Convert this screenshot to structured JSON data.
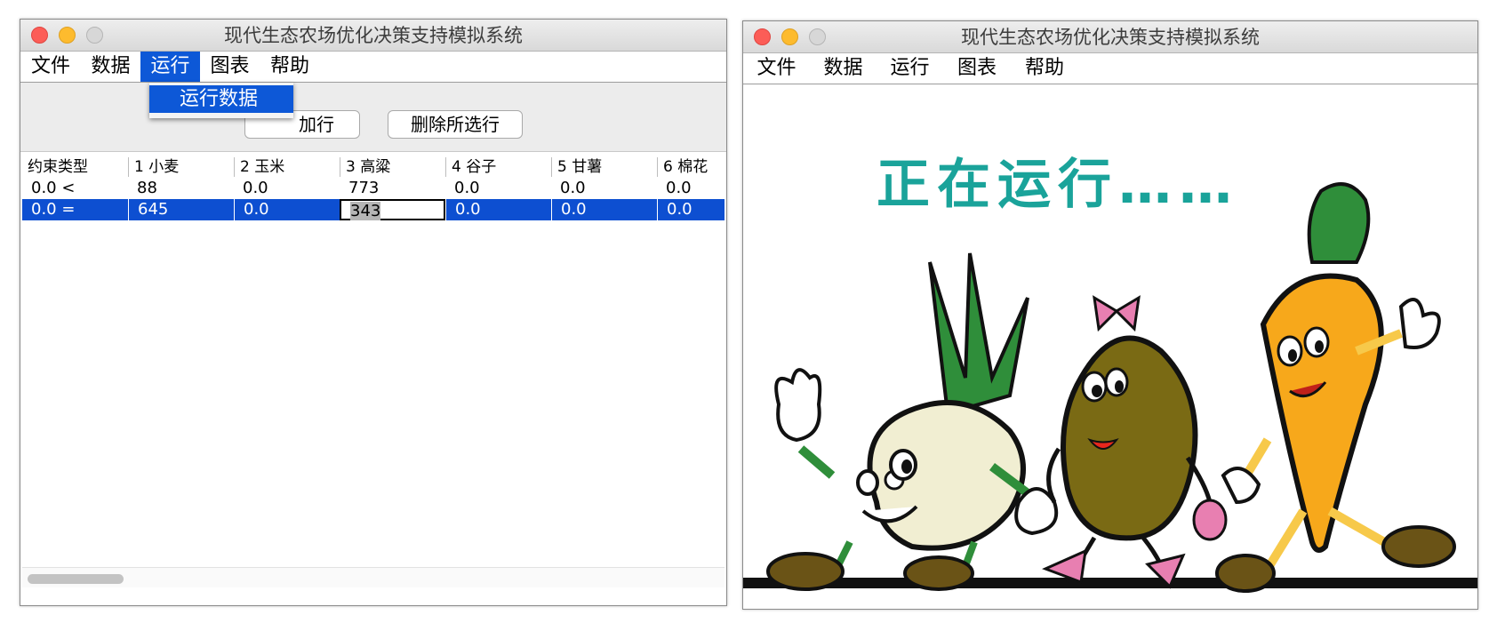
{
  "window1": {
    "title": "现代生态农场优化决策支持模拟系统",
    "menu": [
      "文件",
      "数据",
      "运行",
      "图表",
      "帮助"
    ],
    "active_menu_index": 2,
    "dropdown_item": "运行数据",
    "toolbar": {
      "add_label": "加行",
      "delete_label": "删除所选行"
    },
    "table": {
      "headers": [
        "约束类型",
        "1 小麦",
        "2 玉米",
        "3 高粱",
        "4 谷子",
        "5 甘薯",
        "6 棉花"
      ],
      "rows": [
        [
          "0.0 <",
          "88",
          "0.0",
          "773",
          "0.0",
          "0.0",
          "0.0"
        ],
        [
          "0.0 =",
          "645",
          "0.0",
          "343",
          "0.0",
          "0.0",
          "0.0"
        ]
      ],
      "selected_row": 1,
      "editing_cell": "343"
    }
  },
  "window2": {
    "title": "现代生态农场优化决策支持模拟系统",
    "menu": [
      "文件",
      "数据",
      "运行",
      "图表",
      "帮助"
    ],
    "running_text": "正在运行……"
  },
  "colors": {
    "selection": "#0d4fd1",
    "menu_highlight": "#0d58d7",
    "running_text": "#1aa39a",
    "onion": "#f1eed2",
    "potato": "#7a6a14",
    "carrot": "#f7a81b",
    "leaves": "#2f8e3a"
  },
  "icons": [
    "close-light-icon",
    "minimize-light-icon",
    "maximize-light-icon"
  ]
}
